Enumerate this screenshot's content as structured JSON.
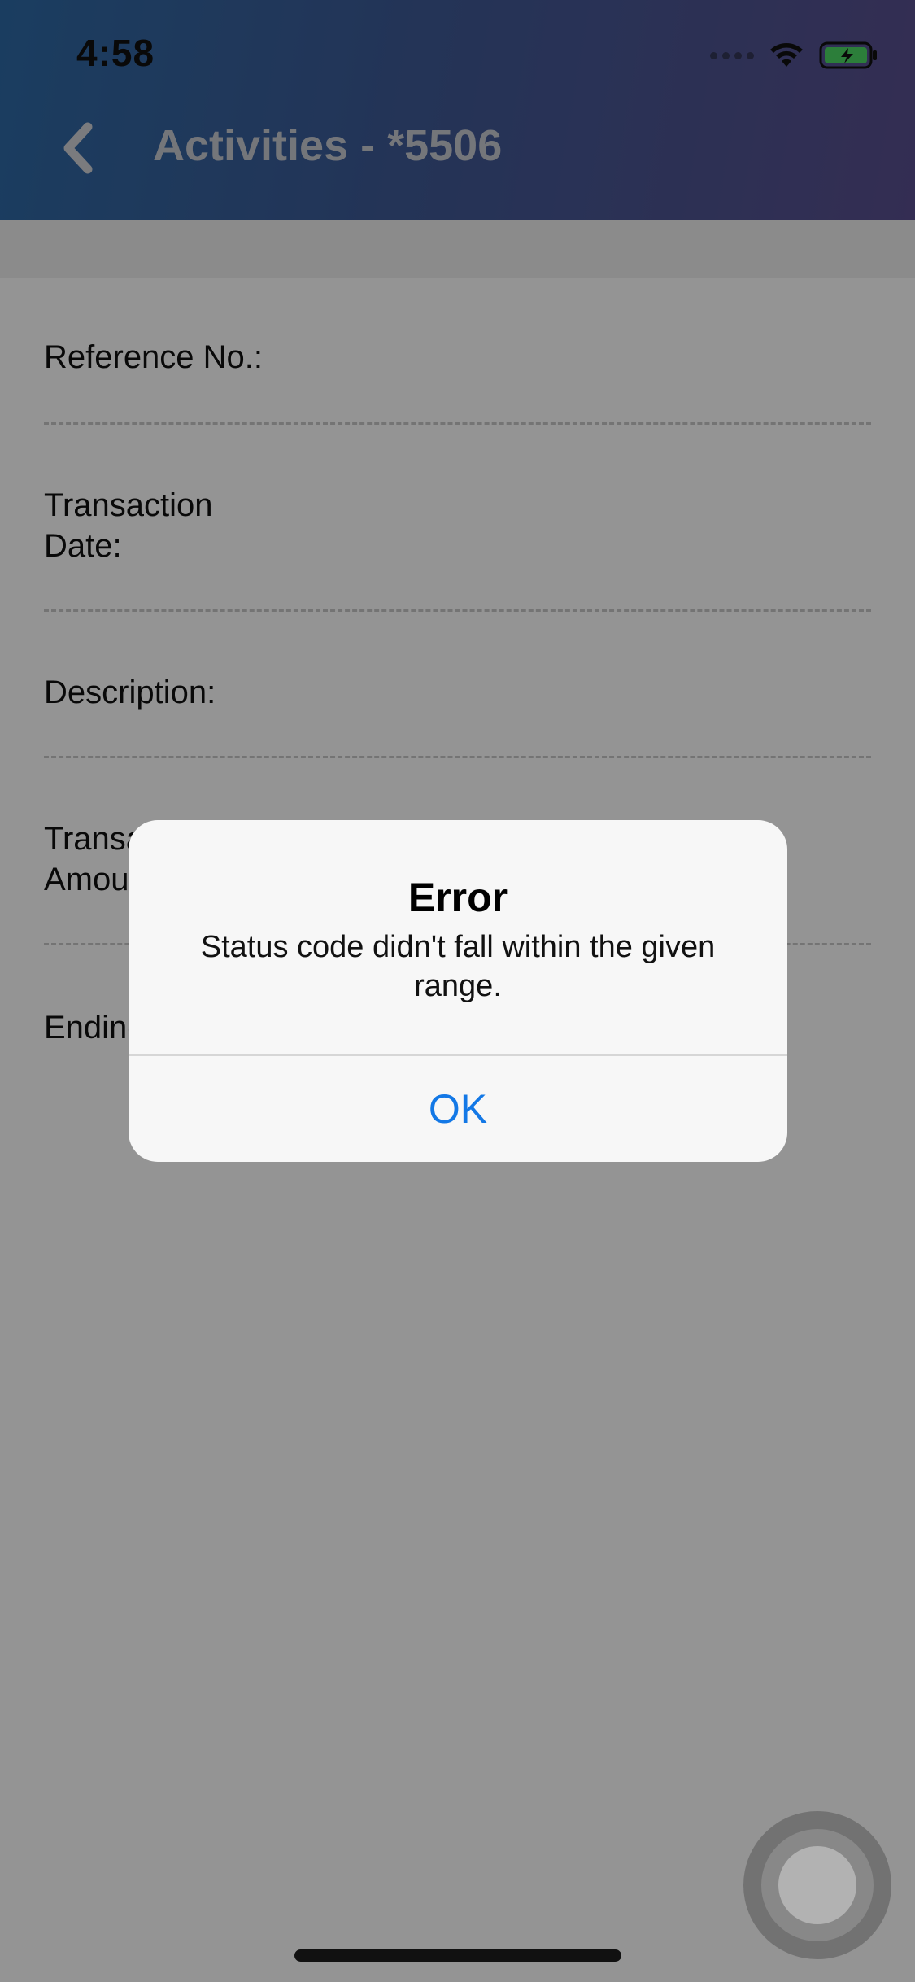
{
  "status_bar": {
    "time": "4:58",
    "icons": [
      "signal-dots-icon",
      "wifi-icon",
      "battery-charging-icon"
    ]
  },
  "header": {
    "title": "Activities - *5506",
    "back_icon": "chevron-left-icon"
  },
  "details": {
    "rows": [
      {
        "label": "Reference No.:"
      },
      {
        "label": "Transaction Date:"
      },
      {
        "label": "Description:"
      },
      {
        "label": "Transaction Amount:"
      },
      {
        "label": "Ending Balance:"
      }
    ]
  },
  "alert": {
    "title": "Error",
    "message": "Status code didn't fall within the given range.",
    "ok_label": "OK"
  },
  "colors": {
    "header_gradient_start": "#2e6aa6",
    "header_gradient_end": "#5a4f8f",
    "alert_button": "#1378e6",
    "battery_fill": "#4cd964"
  }
}
